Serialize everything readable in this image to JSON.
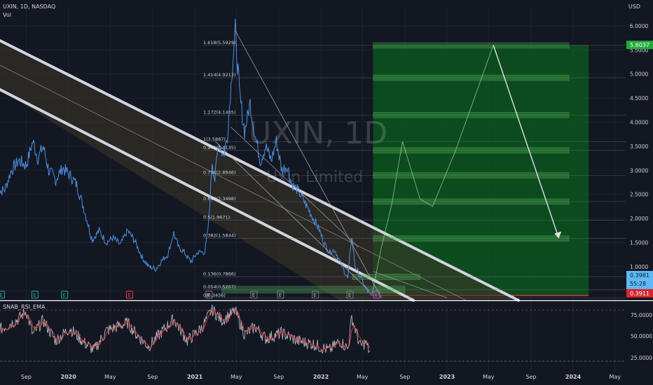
{
  "header": {
    "symbol_line": "UXIN, 1D, NASDAQ",
    "volume_label": "Vol",
    "currency": "USD",
    "watermark_main": "UXIN, 1D",
    "watermark_sub": "Uxin Limited"
  },
  "price_badges": {
    "target": "5.6037",
    "last": "0.3981",
    "countdown": "55:28",
    "bottom": "0.3911"
  },
  "indicator": {
    "name": "SNAB_RSI_EMA",
    "levels": [
      "75.0000",
      "50.0000",
      "25.0000"
    ]
  },
  "earnings_marker_label": "E",
  "chart_data": [
    {
      "type": "line",
      "x_ticks": [
        "Sep",
        "2020",
        "May",
        "Sep",
        "2021",
        "May",
        "Sep",
        "2022",
        "May",
        "Sep",
        "2023",
        "May",
        "Sep",
        "2024",
        "May"
      ],
      "y_ticks": [
        0.5,
        1,
        1.5,
        2,
        2.5,
        3,
        3.5,
        4,
        4.5,
        5,
        5.5,
        6
      ],
      "y_tick_labels": [
        "0.5000",
        "1.0000",
        "1.5000",
        "2.0000",
        "2.5000",
        "3.0000",
        "3.5000",
        "4.0000",
        "4.5000",
        "5.0000",
        "5.5000",
        "6.0000"
      ],
      "ylim": [
        0.3,
        6.1
      ],
      "price_series": [
        [
          "2019-06-10",
          2.55
        ],
        [
          "2019-07-01",
          2.6
        ],
        [
          "2019-07-20",
          3.0
        ],
        [
          "2019-08-10",
          3.2
        ],
        [
          "2019-09-01",
          3.1
        ],
        [
          "2019-09-20",
          3.6
        ],
        [
          "2019-10-05",
          3.25
        ],
        [
          "2019-10-20",
          3.5
        ],
        [
          "2019-11-05",
          3.0
        ],
        [
          "2019-11-25",
          2.8
        ],
        [
          "2019-12-15",
          3.05
        ],
        [
          "2020-01-05",
          2.9
        ],
        [
          "2020-01-25",
          2.7
        ],
        [
          "2020-02-15",
          2.2
        ],
        [
          "2020-03-10",
          1.55
        ],
        [
          "2020-03-30",
          1.75
        ],
        [
          "2020-04-20",
          1.5
        ],
        [
          "2020-05-10",
          1.6
        ],
        [
          "2020-05-30",
          1.45
        ],
        [
          "2020-06-20",
          1.75
        ],
        [
          "2020-07-10",
          1.55
        ],
        [
          "2020-08-01",
          1.2
        ],
        [
          "2020-08-20",
          1.0
        ],
        [
          "2020-09-10",
          0.95
        ],
        [
          "2020-09-30",
          1.15
        ],
        [
          "2020-10-15",
          1.25
        ],
        [
          "2020-11-01",
          1.7
        ],
        [
          "2020-11-15",
          1.4
        ],
        [
          "2020-12-01",
          1.3
        ],
        [
          "2020-12-20",
          1.1
        ],
        [
          "2021-01-10",
          1.3
        ],
        [
          "2021-01-30",
          1.3
        ],
        [
          "2021-02-10",
          1.9
        ],
        [
          "2021-02-20",
          3.2
        ],
        [
          "2021-02-28",
          2.8
        ],
        [
          "2021-03-10",
          3.6
        ],
        [
          "2021-03-25",
          3.3
        ],
        [
          "2021-04-05",
          3.7
        ],
        [
          "2021-04-20",
          5.2
        ],
        [
          "2021-04-28",
          5.9
        ],
        [
          "2021-05-10",
          4.6
        ],
        [
          "2021-05-25",
          3.8
        ],
        [
          "2021-06-10",
          4.4
        ],
        [
          "2021-06-25",
          3.7
        ],
        [
          "2021-07-10",
          3.2
        ],
        [
          "2021-07-25",
          3.5
        ],
        [
          "2021-08-10",
          3.2
        ],
        [
          "2021-08-25",
          3.6
        ],
        [
          "2021-09-10",
          3.0
        ],
        [
          "2021-09-25",
          3.1
        ],
        [
          "2021-10-10",
          2.7
        ],
        [
          "2021-10-25",
          2.6
        ],
        [
          "2021-11-10",
          2.4
        ],
        [
          "2021-11-25",
          2.2
        ],
        [
          "2021-12-10",
          2.0
        ],
        [
          "2021-12-25",
          1.8
        ],
        [
          "2022-01-10",
          1.5
        ],
        [
          "2022-01-25",
          1.3
        ],
        [
          "2022-02-10",
          1.35
        ],
        [
          "2022-02-25",
          1.1
        ],
        [
          "2022-03-10",
          0.9
        ],
        [
          "2022-03-20",
          0.75
        ],
        [
          "2022-03-31",
          1.65
        ],
        [
          "2022-04-10",
          1.0
        ],
        [
          "2022-04-25",
          0.8
        ],
        [
          "2022-05-10",
          0.55
        ],
        [
          "2022-05-25",
          0.4
        ]
      ],
      "rsi": {
        "ylim": [
          10,
          90
        ],
        "levels": [
          75,
          50,
          25
        ],
        "series": [
          [
            "2019-06-10",
            55
          ],
          [
            "2019-07-10",
            62
          ],
          [
            "2019-08-10",
            70
          ],
          [
            "2019-09-01",
            80
          ],
          [
            "2019-09-20",
            50
          ],
          [
            "2019-10-20",
            68
          ],
          [
            "2019-11-25",
            42
          ],
          [
            "2020-01-05",
            58
          ],
          [
            "2020-02-15",
            40
          ],
          [
            "2020-03-15",
            30
          ],
          [
            "2020-04-20",
            55
          ],
          [
            "2020-06-20",
            65
          ],
          [
            "2020-07-20",
            48
          ],
          [
            "2020-08-20",
            35
          ],
          [
            "2020-09-20",
            50
          ],
          [
            "2020-11-01",
            70
          ],
          [
            "2020-12-10",
            42
          ],
          [
            "2021-01-20",
            58
          ],
          [
            "2021-02-20",
            82
          ],
          [
            "2021-03-20",
            68
          ],
          [
            "2021-04-28",
            80
          ],
          [
            "2021-05-25",
            50
          ],
          [
            "2021-06-25",
            60
          ],
          [
            "2021-07-25",
            45
          ],
          [
            "2021-09-10",
            52
          ],
          [
            "2021-10-25",
            42
          ],
          [
            "2021-12-10",
            38
          ],
          [
            "2022-01-25",
            30
          ],
          [
            "2022-02-25",
            42
          ],
          [
            "2022-03-20",
            32
          ],
          [
            "2022-03-31",
            72
          ],
          [
            "2022-04-25",
            35
          ],
          [
            "2022-05-10",
            40
          ],
          [
            "2022-05-25",
            25
          ]
        ]
      },
      "fib_levels": [
        {
          "ratio": "1.618",
          "price": 5.5929,
          "label": "1.618(5.5929)"
        },
        {
          "ratio": "1.414",
          "price": 4.9213,
          "label": "1.414(4.9213)"
        },
        {
          "ratio": "1.172",
          "price": 4.1465,
          "label": "1.172(4.1465)"
        },
        {
          "ratio": "1",
          "price": 3.5887,
          "label": "1(3.5887)"
        },
        {
          "ratio": "0.946",
          "price": 3.4135,
          "label": "0.946(3.4135)"
        },
        {
          "ratio": "0.786",
          "price": 2.8946,
          "label": "0.786(2.8946)"
        },
        {
          "ratio": "0.618",
          "price": 2.3498,
          "label": "0.618(2.3498)"
        },
        {
          "ratio": "0.5",
          "price": 1.9671,
          "label": "0.5(1.9671)"
        },
        {
          "ratio": "0.382",
          "price": 1.5844,
          "label": "0.382(1.5844)"
        },
        {
          "ratio": "0.136",
          "price": 0.7866,
          "label": "0.136(0.7866)"
        },
        {
          "ratio": "0.054",
          "price": 0.5207,
          "label": "0.054(0.5207)"
        },
        {
          "ratio": "0",
          "price": 0.3456,
          "label": "0(0.3456)"
        }
      ],
      "colors": {
        "background": "#131722",
        "price_line": "#4a90e2",
        "channel": "#d1d4dc",
        "channel_fill": "#3d3728",
        "fib_box": "#4caf50",
        "long_zone": "#0b5d1e",
        "target_badge": "#22ab3a",
        "last_badge": "#5eb8f5",
        "bottom_badge": "#d9272e",
        "stop_line": "#f23645",
        "rsi_line": "#b2b5be",
        "rsi_ema": "#e53935",
        "grid": "#1e222d",
        "axis_text": "#d1d4dc"
      }
    }
  ]
}
